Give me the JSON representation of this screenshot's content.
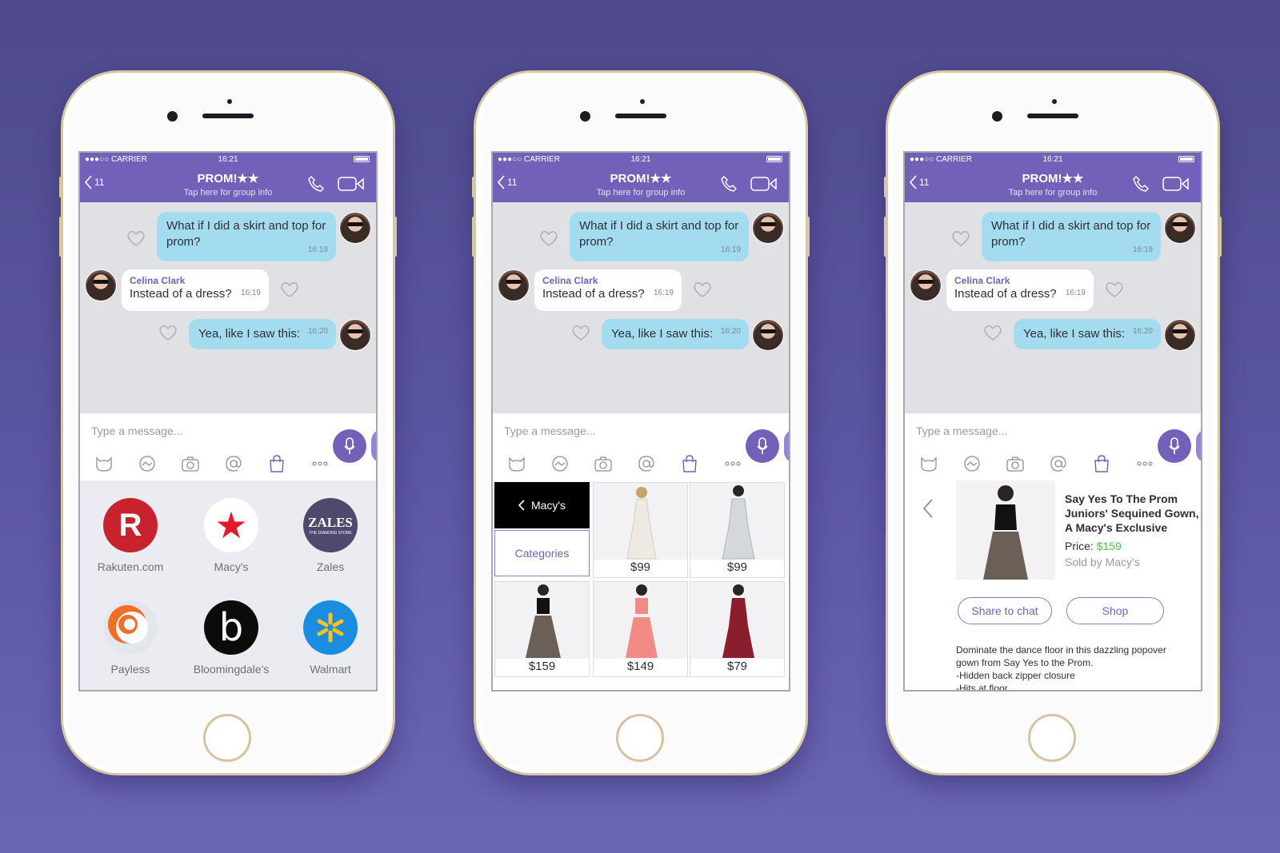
{
  "status": {
    "carrier": "●●●○○ CARRIER",
    "time": "16:21"
  },
  "nav": {
    "back_count": "11",
    "title": "PROM!★★",
    "subtitle": "Tap here for group info"
  },
  "messages": [
    {
      "text": "What if I did a skirt and top for prom?",
      "time": "16:19",
      "direction": "out"
    },
    {
      "sender": "Celina Clark",
      "text": "Instead of a dress?",
      "time": "16:19",
      "direction": "in"
    },
    {
      "text": "Yea, like I saw this:",
      "time": "16:20",
      "direction": "out"
    }
  ],
  "composer": {
    "placeholder": "Type a message...",
    "icons": [
      "sticker-icon",
      "doodle-icon",
      "camera-icon",
      "mention-icon",
      "shopping-bag-icon",
      "more-icon"
    ]
  },
  "colors": {
    "accent": "#7361b9",
    "bubble_out": "#a4dcef",
    "price_green": "#4cc44c"
  },
  "stores": [
    {
      "name": "Rakuten.com",
      "logo": "R"
    },
    {
      "name": "Macy's",
      "logo": "★"
    },
    {
      "name": "Zales",
      "logo": "ZALES",
      "tagline": "THE DIAMOND STORE"
    },
    {
      "name": "Payless",
      "logo": ""
    },
    {
      "name": "Bloomingdale's",
      "logo": "b"
    },
    {
      "name": "Walmart",
      "logo": ""
    }
  ],
  "catalog": {
    "back_label": "Macy's",
    "categories_label": "Categories",
    "prices": [
      "$99",
      "$99",
      "$159",
      "$149",
      "$79"
    ]
  },
  "product": {
    "title": "Say Yes To The Prom Juniors' Sequined Gown, A Macy's Exclusive",
    "price_label": "Price:",
    "price": "$159",
    "seller": "Sold by Macy's",
    "share_label": "Share to chat",
    "shop_label": "Shop",
    "description": "Dominate the dance floor in this dazzling popover gown from Say Yes to the Prom.",
    "bullet1": "-Hidden back zipper closure",
    "bullet2": "-Hits at floor"
  }
}
